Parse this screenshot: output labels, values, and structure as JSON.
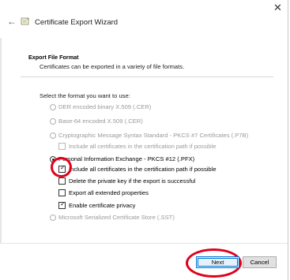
{
  "window": {
    "title": "Certificate Export Wizard",
    "close_glyph": "✕",
    "back_glyph": "←"
  },
  "section": {
    "heading": "Export File Format",
    "subheading": "Certificates can be exported in a variety of file formats."
  },
  "prompt": "Select the format you want to use:",
  "options": {
    "der": "DER encoded binary X.509 (.CER)",
    "base64": "Base-64 encoded X.509 (.CER)",
    "p7b": "Cryptographic Message Syntax Standard - PKCS #7 Certificates (.P7B)",
    "p7b_include": "Include all certificates in the certification path if possible",
    "pfx": "Personal Information Exchange - PKCS #12 (.PFX)",
    "pfx_include": "Include all certificates in the certification path if possible",
    "pfx_delete_key": "Delete the private key if the export is successful",
    "pfx_export_ext": "Export all extended properties",
    "pfx_privacy": "Enable certificate privacy",
    "sst": "Microsoft Serialized Certificate Store (.SST)"
  },
  "buttons": {
    "next": "Next",
    "cancel": "Cancel"
  },
  "colors": {
    "annotation": "#e0001a",
    "focus": "#0078d7"
  }
}
